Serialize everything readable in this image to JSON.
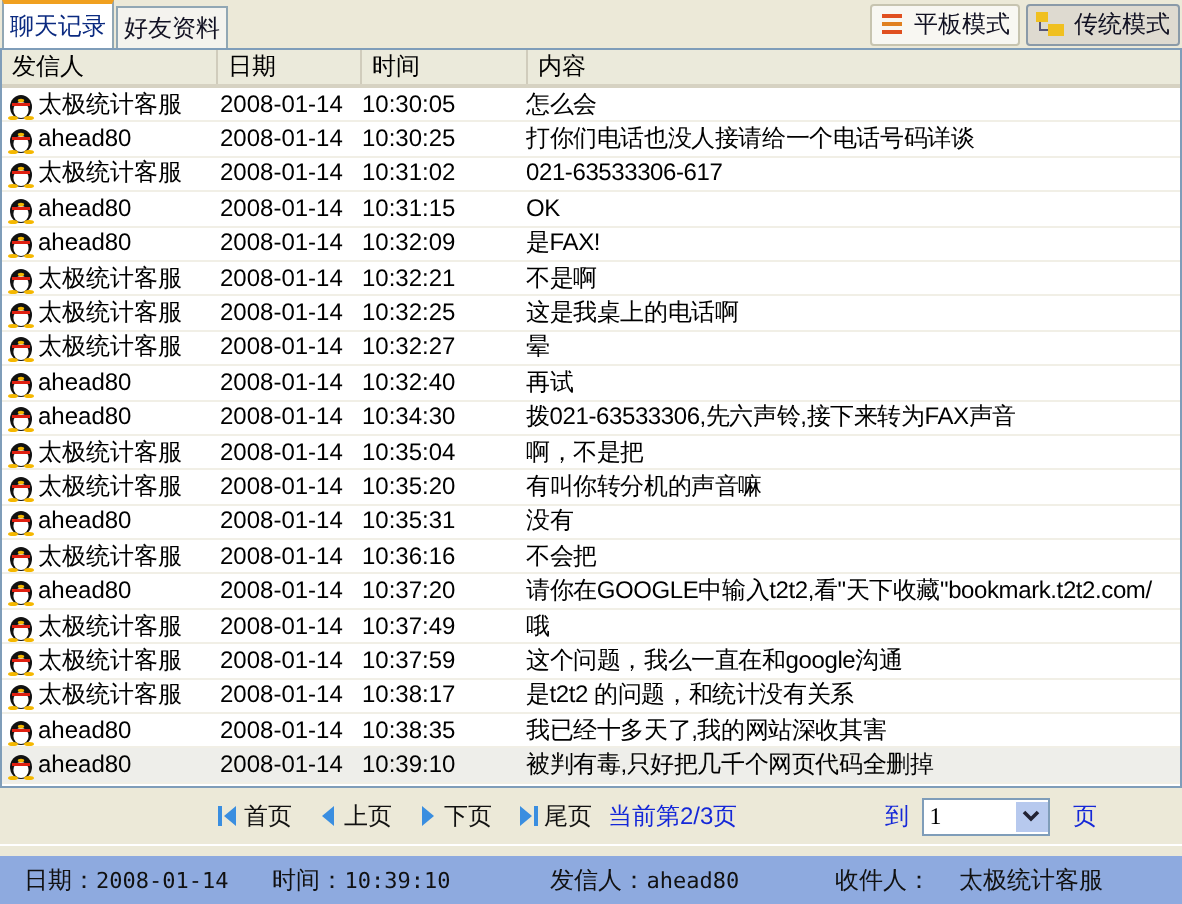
{
  "tabs": [
    {
      "label": "聊天记录",
      "selected": true
    },
    {
      "label": "好友资料",
      "selected": false
    }
  ],
  "modes": [
    {
      "label": "平板模式",
      "kind": "flat",
      "selected": false
    },
    {
      "label": "传统模式",
      "kind": "tree",
      "selected": true
    }
  ],
  "table": {
    "columns": [
      "发信人",
      "日期",
      "时间",
      "内容"
    ],
    "rows": [
      {
        "sender": "太极统计客服",
        "date": "2008-01-14",
        "time": "10:30:05",
        "content": "怎么会",
        "selected": false
      },
      {
        "sender": "ahead80",
        "date": "2008-01-14",
        "time": "10:30:25",
        "content": "打你们电话也没人接请给一个电话号码详谈",
        "selected": false
      },
      {
        "sender": "太极统计客服",
        "date": "2008-01-14",
        "time": "10:31:02",
        "content": "021-63533306-617",
        "selected": false
      },
      {
        "sender": "ahead80",
        "date": "2008-01-14",
        "time": "10:31:15",
        "content": "OK",
        "selected": false
      },
      {
        "sender": "ahead80",
        "date": "2008-01-14",
        "time": "10:32:09",
        "content": "是FAX!",
        "selected": false
      },
      {
        "sender": "太极统计客服",
        "date": "2008-01-14",
        "time": "10:32:21",
        "content": "不是啊",
        "selected": false
      },
      {
        "sender": "太极统计客服",
        "date": "2008-01-14",
        "time": "10:32:25",
        "content": "这是我桌上的电话啊",
        "selected": false
      },
      {
        "sender": "太极统计客服",
        "date": "2008-01-14",
        "time": "10:32:27",
        "content": "晕",
        "selected": false
      },
      {
        "sender": "ahead80",
        "date": "2008-01-14",
        "time": "10:32:40",
        "content": "再试",
        "selected": false
      },
      {
        "sender": "ahead80",
        "date": "2008-01-14",
        "time": "10:34:30",
        "content": "拨021-63533306,先六声铃,接下来转为FAX声音",
        "selected": false
      },
      {
        "sender": "太极统计客服",
        "date": "2008-01-14",
        "time": "10:35:04",
        "content": "啊，不是把",
        "selected": false
      },
      {
        "sender": "太极统计客服",
        "date": "2008-01-14",
        "time": "10:35:20",
        "content": "有叫你转分机的声音嘛",
        "selected": false
      },
      {
        "sender": "ahead80",
        "date": "2008-01-14",
        "time": "10:35:31",
        "content": "没有",
        "selected": false
      },
      {
        "sender": "太极统计客服",
        "date": "2008-01-14",
        "time": "10:36:16",
        "content": "不会把",
        "selected": false
      },
      {
        "sender": "ahead80",
        "date": "2008-01-14",
        "time": "10:37:20",
        "content": "请你在GOOGLE中输入t2t2,看\"天下收藏\"bookmark.t2t2.com/",
        "selected": false
      },
      {
        "sender": "太极统计客服",
        "date": "2008-01-14",
        "time": "10:37:49",
        "content": "哦",
        "selected": false
      },
      {
        "sender": "太极统计客服",
        "date": "2008-01-14",
        "time": "10:37:59",
        "content": "这个问题，我么一直在和google沟通",
        "selected": false
      },
      {
        "sender": "太极统计客服",
        "date": "2008-01-14",
        "time": "10:38:17",
        "content": "是t2t2 的问题，和统计没有关系",
        "selected": false
      },
      {
        "sender": "ahead80",
        "date": "2008-01-14",
        "time": "10:38:35",
        "content": "我已经十多天了,我的网站深收其害",
        "selected": false
      },
      {
        "sender": "ahead80",
        "date": "2008-01-14",
        "time": "10:39:10",
        "content": "被判有毒,只好把几千个网页代码全删掉",
        "selected": true
      }
    ]
  },
  "pager": {
    "links": [
      {
        "label": "首页",
        "kind": "first"
      },
      {
        "label": "上页",
        "kind": "prev"
      },
      {
        "label": "下页",
        "kind": "next"
      },
      {
        "label": "尾页",
        "kind": "last"
      }
    ],
    "current": "当前第2/3页",
    "goto_label": "到",
    "page_value": "1",
    "page_suffix": "页"
  },
  "status_bar": [
    {
      "label": "日期：",
      "value": "2008-01-14"
    },
    {
      "label": "时间：",
      "value": "10:39:10"
    },
    {
      "label": "发信人：",
      "value": "ahead80"
    },
    {
      "label": "收件人：",
      "value": "太极统计客服"
    }
  ]
}
